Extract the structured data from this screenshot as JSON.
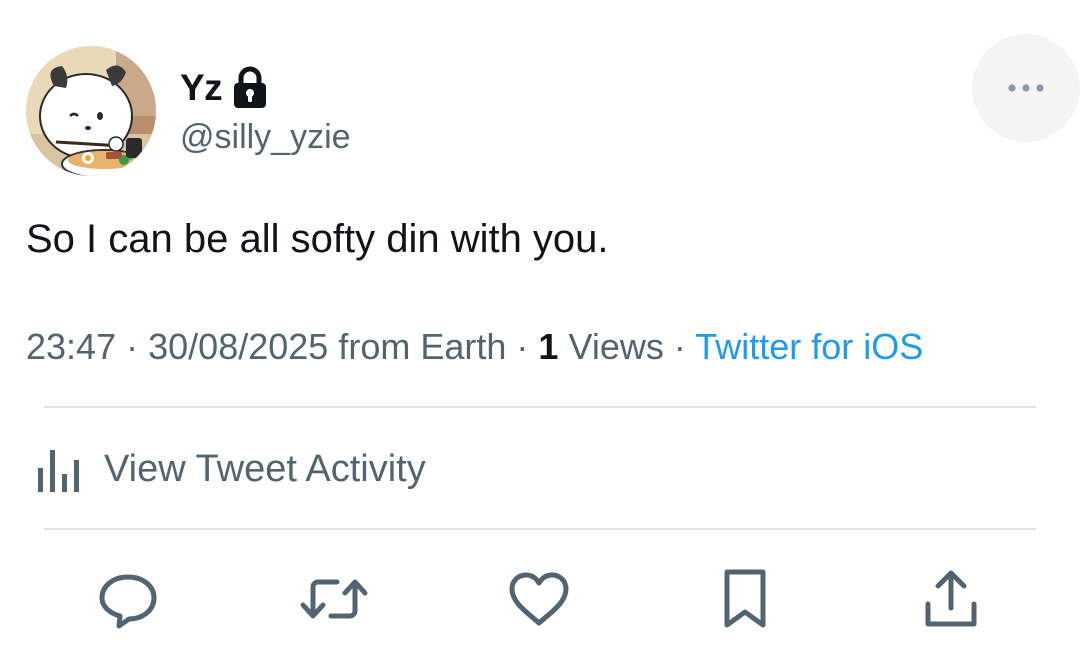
{
  "author": {
    "display_name": "Yz",
    "handle": "@silly_yzie",
    "protected": true,
    "avatar_icon": "cartoon-puppy-eating-ramen"
  },
  "tweet": {
    "text": "So I can be all softy din with you."
  },
  "meta": {
    "time": "23:47",
    "date": "30/08/2025",
    "location": "from Earth",
    "separator": "·",
    "views_count": "1",
    "views_label": "Views",
    "source": "Twitter for iOS"
  },
  "activity": {
    "label": "View Tweet Activity",
    "icon": "bar-chart-icon"
  },
  "actions": [
    {
      "name": "reply",
      "icon": "speech-bubble-icon"
    },
    {
      "name": "retweet",
      "icon": "retweet-arrows-icon"
    },
    {
      "name": "like",
      "icon": "heart-icon"
    },
    {
      "name": "bookmark",
      "icon": "bookmark-icon"
    },
    {
      "name": "share",
      "icon": "share-upload-icon"
    }
  ],
  "colors": {
    "text_primary": "#0f1419",
    "text_secondary": "#536471",
    "link_blue": "#1d9bf0",
    "divider": "#dfe3e6",
    "more_button_bg": "#f4f4f4"
  }
}
